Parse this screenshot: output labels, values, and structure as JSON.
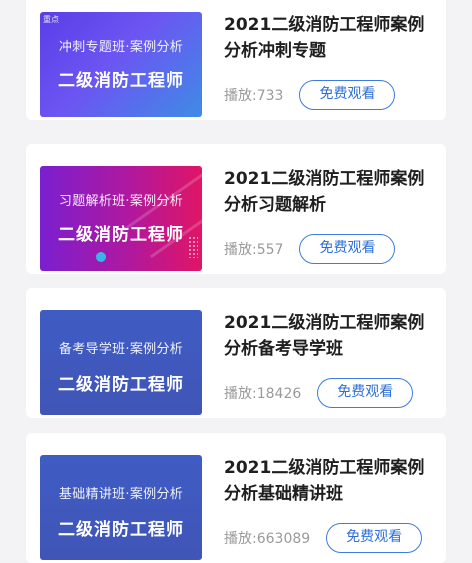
{
  "courses": [
    {
      "badge": "重点",
      "thumb_subtitle": "冲刺专题班·案例分析",
      "thumb_title": "二级消防工程师",
      "title": "2021二级消防工程师案例分析冲刺专题",
      "plays": "播放:733",
      "watch_label": "免费观看"
    },
    {
      "thumb_subtitle": "习题解析班·案例分析",
      "thumb_title": "二级消防工程师",
      "title": "2021二级消防工程师案例分析习题解析",
      "plays": "播放:557",
      "watch_label": "免费观看"
    },
    {
      "thumb_subtitle": "备考导学班·案例分析",
      "thumb_title": "二级消防工程师",
      "title": "2021二级消防工程师案例分析备考导学班",
      "plays": "播放:18426",
      "watch_label": "免费观看"
    },
    {
      "thumb_subtitle": "基础精讲班·案例分析",
      "thumb_title": "二级消防工程师",
      "title": "2021二级消防工程师案例分析基础精讲班",
      "plays": "播放:663089",
      "watch_label": "免费观看"
    }
  ],
  "colors": {
    "accent": "#2f6fd6",
    "title_text": "#1f1f1f",
    "meta_text": "#9a9a9a",
    "background": "#f3f3f5"
  }
}
